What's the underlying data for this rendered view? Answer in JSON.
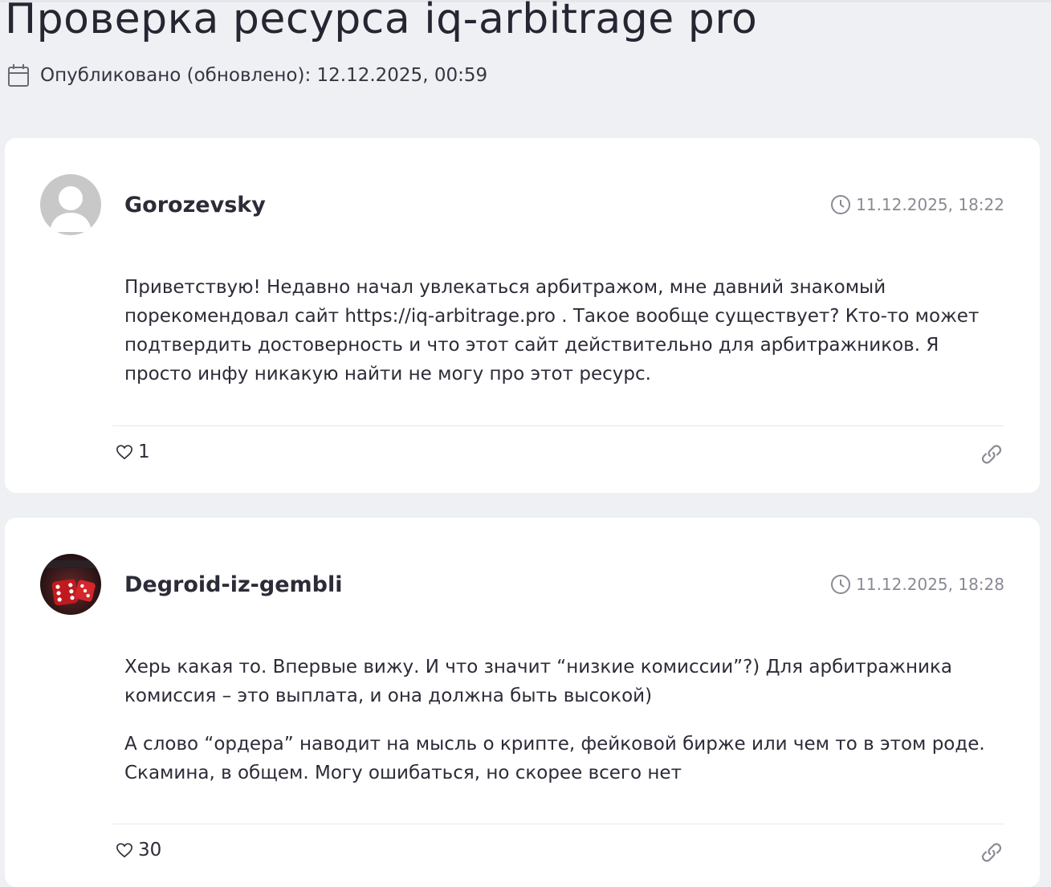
{
  "page": {
    "title": "Проверка ресурса iq-arbitrage pro",
    "published_label": "Опубликовано (обновлено): 12.12.2025, 00:59"
  },
  "comments": [
    {
      "author": "Gorozevsky",
      "time": "11.12.2025, 18:22",
      "avatar_icon": "default-user-avatar",
      "paragraphs": [
        "Приветствую! Недавно начал увлекаться арбитражом, мне давний знакомый порекомендовал сайт https://iq-arbitrage.pro . Такое вообще существует? Кто-то может подтвердить достоверность и что этот сайт действительно для арбитражников. Я просто инфу никакую найти не могу про этот ресурс."
      ],
      "likes": "1"
    },
    {
      "author": "Degroid-iz-gembli",
      "time": "11.12.2025, 18:28",
      "avatar_icon": "red-dice-avatar",
      "paragraphs": [
        "Херь какая то. Впервые вижу. И что значит “низкие комиссии”?) Для арбитражника комиссия – это выплата, и она должна быть высокой)",
        "А слово “ордера” наводит на мысль о крипте, фейковой бирже или чем то в этом роде. Скамина, в общем. Могу ошибаться, но скорее всего нет"
      ],
      "likes": "30"
    }
  ],
  "icons": {
    "calendar": "calendar-icon",
    "clock": "clock-icon",
    "heart": "heart-icon",
    "link": "link-icon"
  },
  "colors": {
    "background": "#eef0f3",
    "card": "#ffffff",
    "text": "#2c2c38",
    "muted": "#8a8a95"
  }
}
